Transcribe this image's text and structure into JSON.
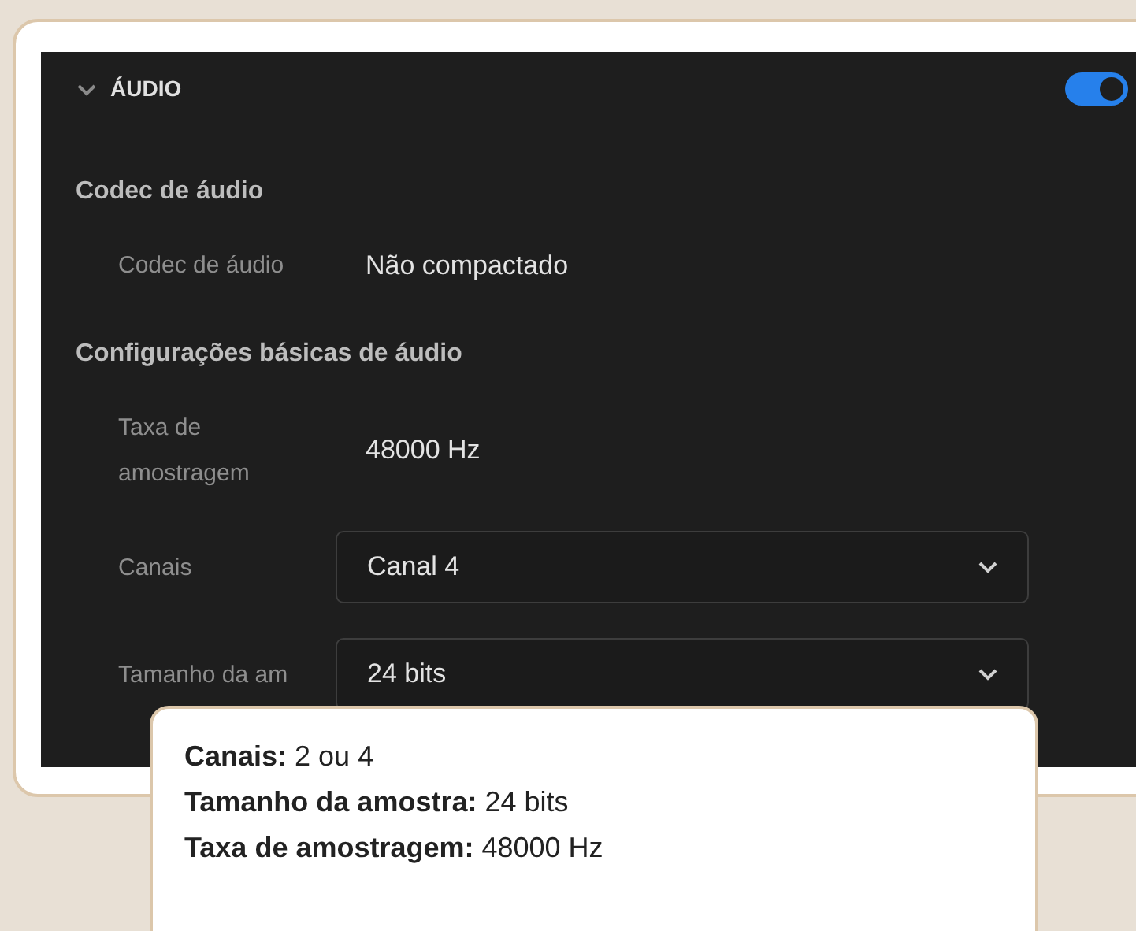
{
  "section": {
    "title": "ÁUDIO",
    "expanded": true,
    "enabled": true
  },
  "groups": [
    {
      "heading": "Codec de áudio",
      "rows": [
        {
          "kind": "text",
          "label": "Codec de áudio",
          "value": "Não compactado"
        }
      ]
    },
    {
      "heading": "Configurações básicas de áudio",
      "rows": [
        {
          "kind": "text",
          "label": "Taxa de amostragem",
          "value": "48000 Hz"
        },
        {
          "kind": "select",
          "label": "Canais",
          "value": "Canal 4"
        },
        {
          "kind": "select",
          "label": "Tamanho da am",
          "value": "24 bits"
        }
      ]
    }
  ],
  "tooltip": {
    "lines": [
      "**Canais:** 2 ou 4",
      "**Tamanho da amostra:** 24 bits",
      "**Taxa de amostragem:** 48000 Hz"
    ]
  }
}
